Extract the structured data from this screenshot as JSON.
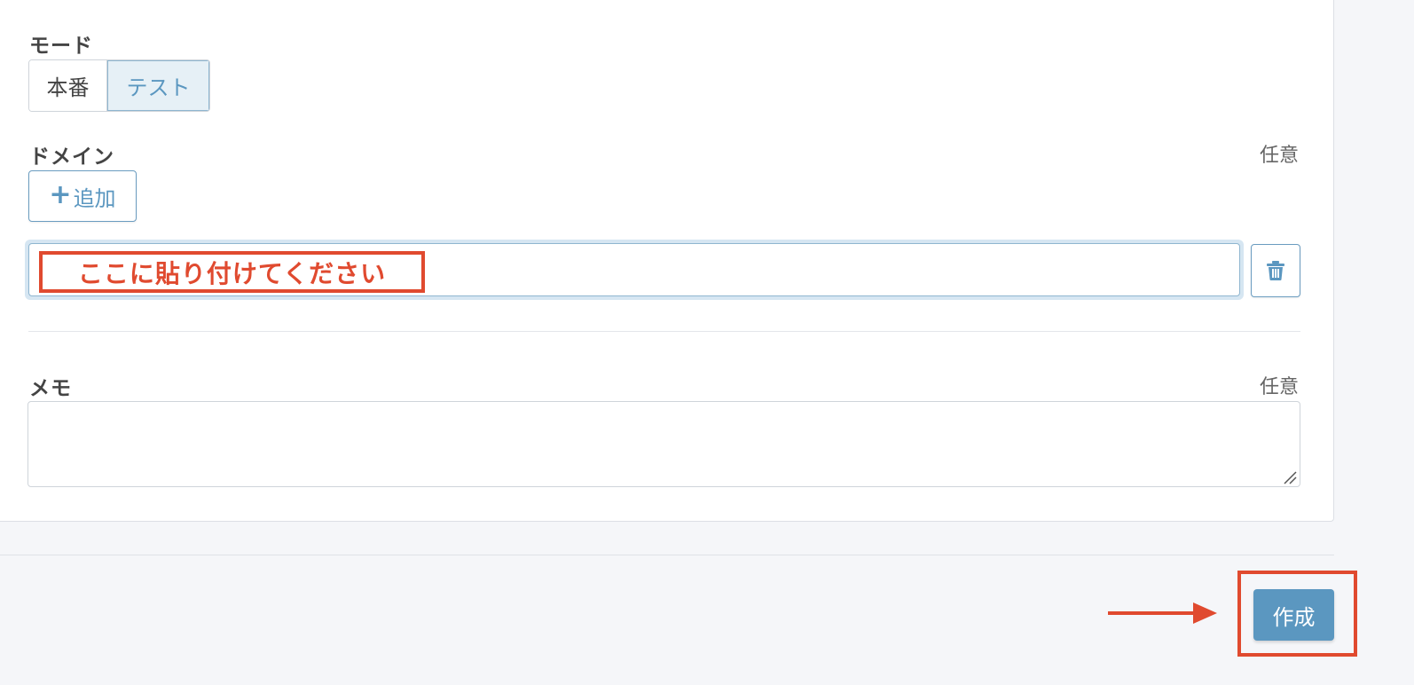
{
  "mode": {
    "label": "モード",
    "options": [
      "本番",
      "テスト"
    ],
    "selected": "テスト"
  },
  "domain": {
    "label": "ドメイン",
    "optional_label": "任意",
    "add_button_label": "追加",
    "add_button_icon": "plus-icon",
    "input_value": "",
    "delete_icon": "trash-icon"
  },
  "annotation": {
    "paste_hint": "ここに貼り付けてください",
    "color": "#e04a2f"
  },
  "memo": {
    "label": "メモ",
    "optional_label": "任意",
    "value": ""
  },
  "footer": {
    "create_button_label": "作成"
  },
  "colors": {
    "accent": "#5b97c0",
    "annotation": "#e04a2f"
  }
}
